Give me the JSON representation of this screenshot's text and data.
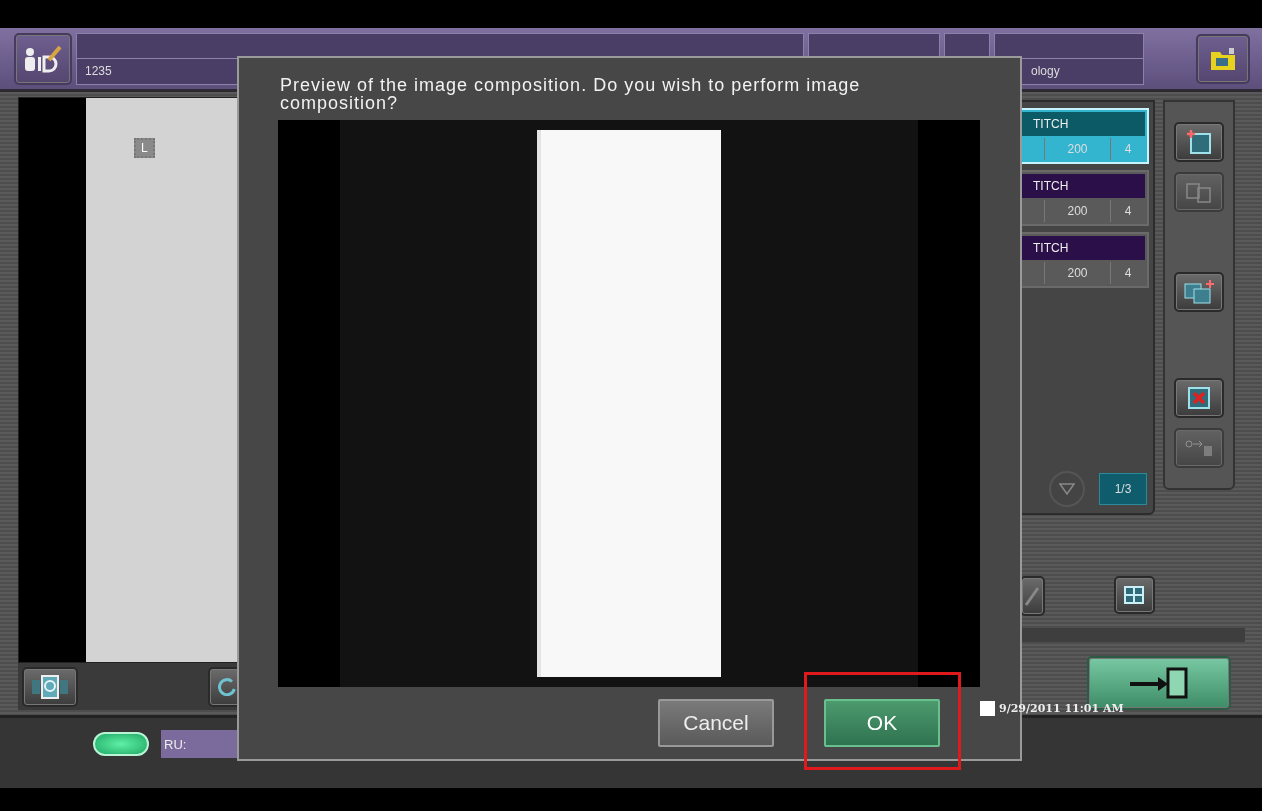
{
  "header": {
    "patient_id": "1235",
    "department": "ology"
  },
  "viewer": {
    "marker": "L"
  },
  "exam_list": {
    "items": [
      {
        "name": "TITCH",
        "value_1": "200",
        "value_2": "4",
        "selected": true
      },
      {
        "name": "TITCH",
        "value_1": "200",
        "value_2": "4",
        "selected": false
      },
      {
        "name": "TITCH",
        "value_1": "200",
        "value_2": "4",
        "selected": false
      }
    ],
    "page": "1/3"
  },
  "status_bar": {
    "ru_label": "RU:",
    "datetime": "9/29/2011 11:01 AM"
  },
  "dialog": {
    "message": "Preview of the image composition. Do you wish to perform image composition?",
    "buttons": [
      {
        "label": "Cancel",
        "kind": "secondary",
        "highlighted": false
      },
      {
        "label": "OK",
        "kind": "primary",
        "highlighted": true
      }
    ]
  }
}
